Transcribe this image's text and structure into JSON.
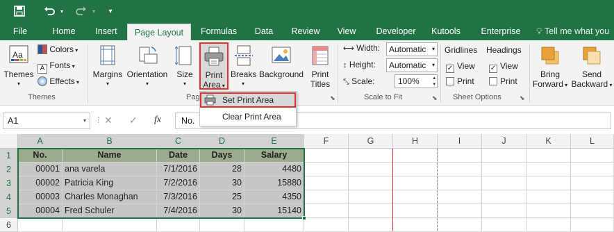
{
  "qat": {
    "save": "save-icon",
    "undo": "undo-icon",
    "redo": "redo-icon"
  },
  "tabs": [
    {
      "label": "File"
    },
    {
      "label": "Home"
    },
    {
      "label": "Insert"
    },
    {
      "label": "Page Layout"
    },
    {
      "label": "Formulas"
    },
    {
      "label": "Data"
    },
    {
      "label": "Review"
    },
    {
      "label": "View"
    },
    {
      "label": "Developer"
    },
    {
      "label": "Kutools"
    },
    {
      "label": "Enterprise"
    }
  ],
  "tellme": "Tell me what you",
  "ribbon": {
    "themes": {
      "label": "Themes",
      "colors": "Colors",
      "fonts": "Fonts",
      "effects": "Effects",
      "group": "Themes"
    },
    "margins": "Margins",
    "orientation": "Orientation",
    "size": "Size",
    "print_area": {
      "line1": "Print",
      "line2": "Area"
    },
    "breaks": "Breaks",
    "background": "Background",
    "print_titles": {
      "line1": "Print",
      "line2": "Titles"
    },
    "page_setup_group": "Pag",
    "scale": {
      "width_label": "Width:",
      "width_value": "Automatic",
      "height_label": "Height:",
      "height_value": "Automatic",
      "scale_label": "Scale:",
      "scale_value": "100%",
      "group": "Scale to Fit"
    },
    "sheet_options": {
      "gridlines": "Gridlines",
      "headings": "Headings",
      "view": "View",
      "print": "Print",
      "group": "Sheet Options"
    },
    "bring_forward": {
      "line1": "Bring",
      "line2": "Forward"
    },
    "send_backward": {
      "line1": "Send",
      "line2": "Backward"
    }
  },
  "print_area_menu": {
    "set": "Set Print Area",
    "clear": "Clear Print Area"
  },
  "formula_bar": {
    "name_box": "A1",
    "fx": "fx",
    "formula": "No."
  },
  "sheet": {
    "columns": [
      "A",
      "B",
      "C",
      "D",
      "E",
      "F",
      "G",
      "H",
      "I",
      "J",
      "K",
      "L"
    ],
    "rows": [
      "1",
      "2",
      "3",
      "4",
      "5",
      "6"
    ],
    "headers": [
      "No.",
      "Name",
      "Date",
      "Days",
      "Salary"
    ],
    "data": [
      [
        "00001",
        "ana varela",
        "7/1/2016",
        "28",
        "4480"
      ],
      [
        "00002",
        "Patricia King",
        "7/2/2016",
        "30",
        "15880"
      ],
      [
        "00003",
        "Charles Monaghan",
        "7/3/2016",
        "25",
        "4350"
      ],
      [
        "00004",
        "Fred Schuler",
        "7/4/2016",
        "30",
        "15140"
      ]
    ]
  },
  "colors": {
    "excel_green": "#217346",
    "highlight_red": "#e03030",
    "header_fill": "#9bab8e",
    "data_fill": "#c6c6c6"
  }
}
